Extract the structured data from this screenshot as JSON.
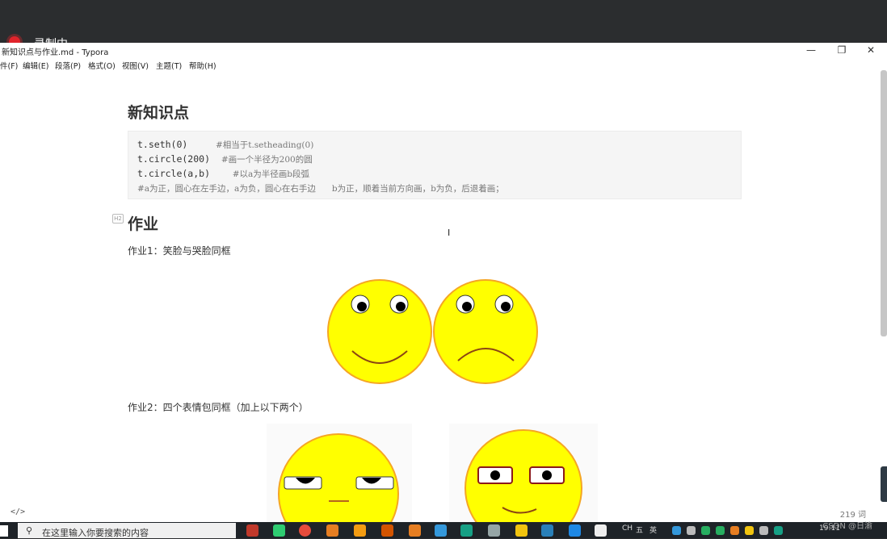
{
  "recording": {
    "label": "录制中"
  },
  "window": {
    "title": "新知识点与作业.md - Typora",
    "controls": {
      "minimize": "—",
      "maximize": "❐",
      "close": "✕"
    }
  },
  "menu": [
    "件(F)",
    "编辑(E)",
    "段落(P)",
    "格式(O)",
    "视图(V)",
    "主题(T)",
    "帮助(H)"
  ],
  "doc": {
    "heading1": "新知识点",
    "code": [
      {
        "code": "t.seth(0)     ",
        "comment": "#相当于t.setheading(0)"
      },
      {
        "code": "t.circle(200)  ",
        "comment": "#画一个半径为200的圆"
      },
      {
        "code": "t.circle(a,b)    ",
        "comment": "#以a为半径画b段弧"
      },
      {
        "code": "",
        "comment": "#a为正，圆心在左手边，a为负，圆心在右手边      b为正，顺着当前方向画，b为负，后退着画；"
      }
    ],
    "heading2": "作业",
    "hw1": "作业1：笑脸与哭脸同框",
    "hw2": "作业2：四个表情包同框（加上以下两个）"
  },
  "status": {
    "source_toggle": "</>",
    "word_count": "219 词"
  },
  "taskbar": {
    "search_placeholder": "在这里输入你要搜索的内容",
    "ime": [
      "CH",
      "五",
      "英"
    ],
    "clock": "19:11"
  },
  "watermark": "CSDN @日渝",
  "colors": {
    "face_fill": "#ffff00",
    "face_stroke": "#f5a623",
    "code_bg": "#f5f5f5"
  }
}
